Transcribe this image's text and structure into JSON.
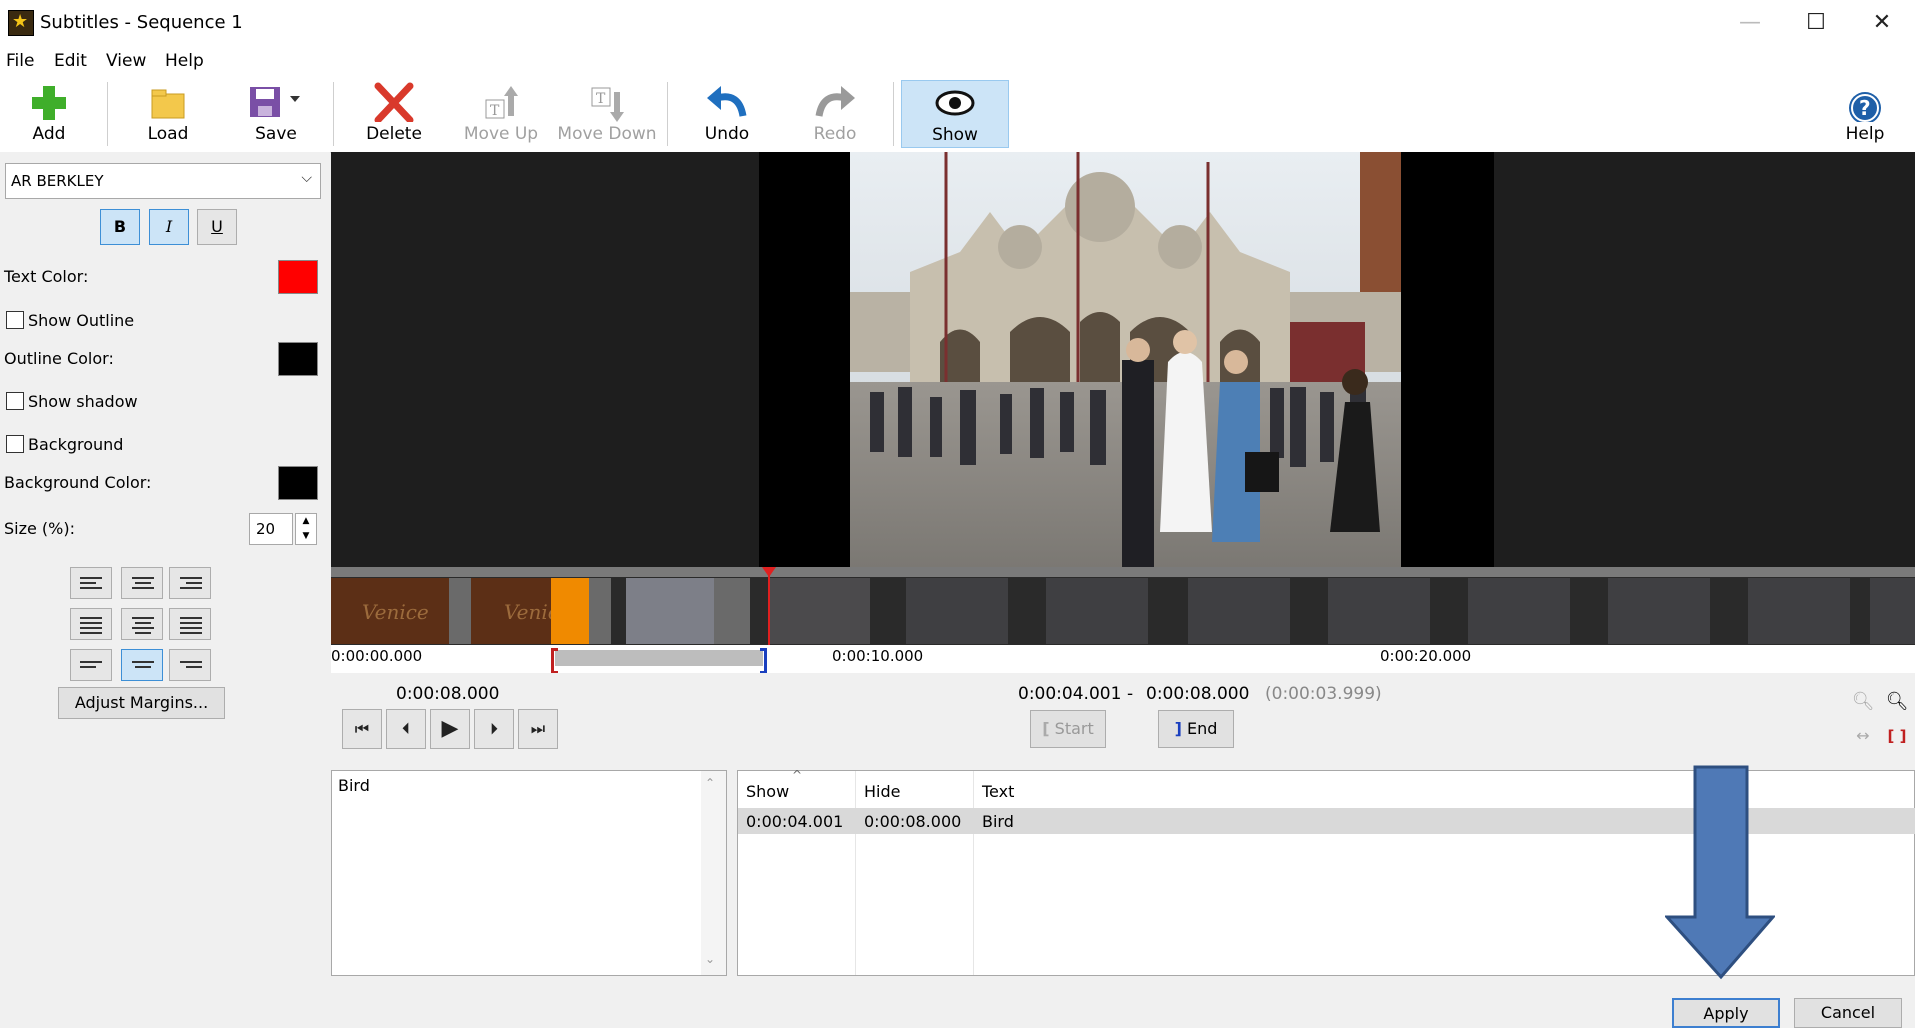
{
  "window": {
    "title": "Subtitles - Sequence 1",
    "minimize": "—",
    "maximize": "☐",
    "close": "✕"
  },
  "menu": [
    "File",
    "Edit",
    "View",
    "Help"
  ],
  "toolbar": {
    "add": "Add",
    "load": "Load",
    "save": "Save",
    "delete": "Delete",
    "move_up": "Move Up",
    "move_down": "Move Down",
    "undo": "Undo",
    "redo": "Redo",
    "show": "Show",
    "help": "Help"
  },
  "style_panel": {
    "font": "AR BERKLEY",
    "bold": "B",
    "italic": "I",
    "underline": "U",
    "text_color_label": "Text Color:",
    "text_color": "#ff0000",
    "show_outline": "Show Outline",
    "outline_color_label": "Outline Color:",
    "outline_color": "#000000",
    "show_shadow": "Show shadow",
    "background": "Background",
    "background_color_label": "Background Color:",
    "background_color": "#000000",
    "size_label": "Size (%):",
    "size_value": "20",
    "adjust_margins": "Adjust Margins..."
  },
  "timeline": {
    "frame_text_1": "Venice",
    "frame_text_2": "Venice",
    "tick_0": "0:00:00.000",
    "tick_10": "0:00:10.000",
    "tick_20": "0:00:20.000"
  },
  "transport": {
    "current_time": "0:00:08.000",
    "range_start": "0:00:04.001",
    "range_dash": "-",
    "range_end": "0:00:08.000",
    "range_duration": "(0:00:03.999)",
    "start_label": "Start",
    "end_label": "End"
  },
  "editor": {
    "text": "Bird"
  },
  "table": {
    "columns": [
      "Show",
      "Hide",
      "Text"
    ],
    "rows": [
      {
        "show": "0:00:04.001",
        "hide": "0:00:08.000",
        "text": "Bird"
      }
    ]
  },
  "dialog_buttons": {
    "apply": "Apply",
    "cancel": "Cancel"
  }
}
